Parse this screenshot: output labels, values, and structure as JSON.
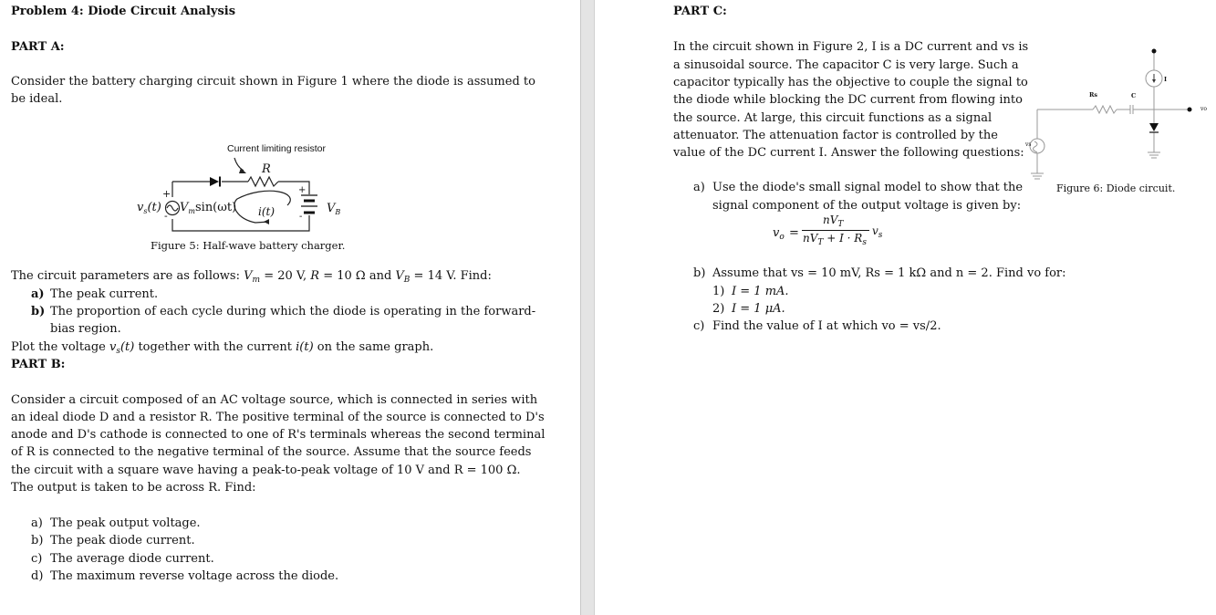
{
  "left": {
    "title": "Problem 4: Diode Circuit Analysis",
    "part_a": {
      "heading": "PART A:",
      "intro": [
        "Consider the battery charging circuit shown in Figure 1 where the diode is assumed to",
        "be ideal."
      ],
      "figure": {
        "annotation": "Current limiting resistor",
        "resistor_label": "R",
        "source_label_left": "v",
        "source_label_left_sub": "s",
        "source_label_left_arg": "(t)",
        "source_expr_prefix": "V",
        "source_expr_sub": "m",
        "source_expr_suffix": "sin(ωt)",
        "current_label": "i(t)",
        "battery_label": "V",
        "battery_label_sub": "B",
        "plus": "+",
        "minus": "-",
        "caption": "Figure 5: Half-wave battery charger."
      },
      "params_line": "The circuit parameters are as follows: Vm = 20 V, R = 10 Ω and VB = 14 V. Find:",
      "params": {
        "prefix": "The circuit parameters are as follows: ",
        "vm_sym": "V",
        "vm_sub": "m",
        "vm_val": " = 20 V, ",
        "r_sym": "R",
        "r_val": " = 10 Ω and ",
        "vb_sym": "V",
        "vb_sub": "B",
        "vb_val": " = 14 V. Find:"
      },
      "questions": [
        {
          "marker": "a)",
          "text": "The peak current."
        },
        {
          "marker": "b)",
          "text": "The proportion of each cycle during which the diode is operating in the forward-",
          "cont": "bias region."
        }
      ],
      "plot_line": {
        "prefix": "Plot the voltage ",
        "v": "v",
        "v_sub": "s",
        "t1": "(t)",
        "mid": " together with the current ",
        "i": "i",
        "t2": "(t)",
        "suffix": " on the same graph."
      }
    },
    "part_b": {
      "heading": "PART B:",
      "paragraph": [
        "Consider a circuit composed of an AC voltage source, which is connected in series with",
        "an ideal diode D and a resistor R. The positive terminal of the source is connected to D's",
        "anode and D's cathode is connected to one of R's terminals whereas the second terminal",
        "of R is connected to the negative terminal of the source. Assume that the source feeds",
        "the circuit with a square wave having a peak-to-peak voltage of 10 V and R = 100 Ω.",
        "The output is taken to be across R. Find:"
      ],
      "questions": [
        {
          "marker": "a)",
          "text": "The peak output voltage."
        },
        {
          "marker": "b)",
          "text": "The peak diode current."
        },
        {
          "marker": "c)",
          "text": "The average diode current."
        },
        {
          "marker": "d)",
          "text": "The maximum reverse voltage across the diode."
        }
      ]
    }
  },
  "right": {
    "part_c": {
      "heading": "PART C:",
      "paragraph": [
        "In the circuit shown in Figure 2, I is a DC current and vs is",
        "a sinusoidal source. The capacitor C is very large. Such a",
        "capacitor typically has the objective to couple the signal to",
        "the diode while blocking the DC current from flowing into",
        "the source. At large, this circuit functions as a signal",
        "attenuator. The attenuation factor is controlled by the",
        "value of the DC current I. Answer the following questions:"
      ],
      "figure": {
        "rs_label": "Rs",
        "c_label": "C",
        "i_label": "I",
        "vs_label": "vs",
        "vo_label": "vo",
        "caption": "Figure 6: Diode circuit."
      },
      "q_a": {
        "marker": "a)",
        "line1": "Use the diode's small signal model to show that the",
        "line2": "signal component of the output voltage is given by:",
        "formula": {
          "lhs": "v",
          "lhs_sub": "o",
          "eq": "=",
          "num": "nV",
          "num_sub": "T",
          "den": "nV",
          "den_sub": "T",
          "den_rest": " + I · R",
          "den_rest_sub": "s",
          "rhs": "v",
          "rhs_sub": "s"
        }
      },
      "q_b": {
        "marker": "b)",
        "text": "Assume that vs = 10 mV, Rs = 1 kΩ and n = 2. Find vo for:",
        "items": [
          {
            "marker": "1)",
            "text": "I = 1 mA."
          },
          {
            "marker": "2)",
            "text": "I = 1 μA."
          }
        ]
      },
      "q_c": {
        "marker": "c)",
        "text": "Find the value of I at which vo = vs/2."
      }
    }
  }
}
